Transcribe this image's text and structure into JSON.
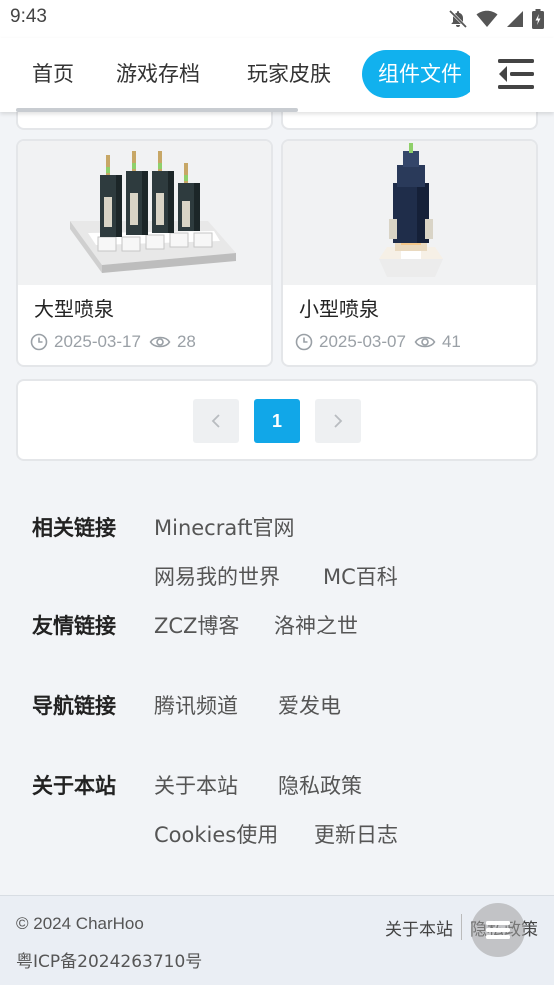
{
  "status_bar": {
    "time": "9:43"
  },
  "nav": {
    "tabs": [
      {
        "label": "首页"
      },
      {
        "label": "游戏存档"
      },
      {
        "label": "玩家皮肤"
      },
      {
        "label": "组件文件"
      }
    ],
    "active_tab": "组件文件",
    "accent_color": "#11b1ee"
  },
  "cards": [
    {
      "title": "大型喷泉",
      "date": "2025-03-17",
      "views": "28"
    },
    {
      "title": "小型喷泉",
      "date": "2025-03-07",
      "views": "41"
    }
  ],
  "pagination": {
    "current_page": "1"
  },
  "link_groups": [
    {
      "label": "相关链接",
      "links": [
        "Minecraft官网",
        "网易我的世界",
        "MC百科"
      ]
    },
    {
      "label": "友情链接",
      "links": [
        "ZCZ博客",
        "洛神之世"
      ]
    },
    {
      "label": "导航链接",
      "links": [
        "腾讯频道",
        "爱发电"
      ]
    },
    {
      "label": "关于本站",
      "links": [
        "关于本站",
        "隐私政策",
        "Cookies使用",
        "更新日志"
      ]
    }
  ],
  "footer": {
    "copyright": "© 2024 CharHoo",
    "icp": "粤ICP备2024263710号",
    "links": [
      "关于本站",
      "隐私政策"
    ]
  }
}
